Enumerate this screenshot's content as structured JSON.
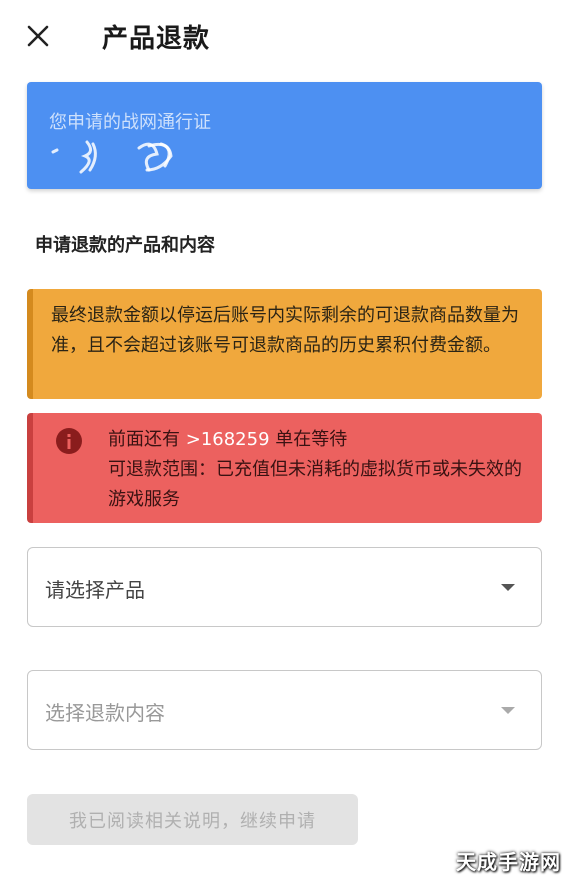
{
  "header": {
    "close_icon": "close-icon",
    "title": "产品退款"
  },
  "pass_card": {
    "label": "您申请的战网通行证",
    "id_obscured": true,
    "color": "#4d90f2"
  },
  "section": {
    "title": "申请退款的产品和内容"
  },
  "notice_orange": {
    "text": "最终退款金额以停运后账号内实际剩余的可退款商品数量为准，且不会超过该账号可退款商品的历史累积付费金额。",
    "color": "#f0a83d"
  },
  "notice_red": {
    "icon": "info-icon",
    "queue_prefix": "前面还有 ",
    "queue_count": ">168259",
    "queue_suffix": " 单在等待",
    "scope_text": "可退款范围：已充值但未消耗的虚拟货币或未失效的游戏服务",
    "color": "#ec615f"
  },
  "form": {
    "product_select_placeholder": "请选择产品",
    "content_select_placeholder": "选择退款内容",
    "continue_label": "我已阅读相关说明，继续申请"
  },
  "watermark": "天成手游网"
}
